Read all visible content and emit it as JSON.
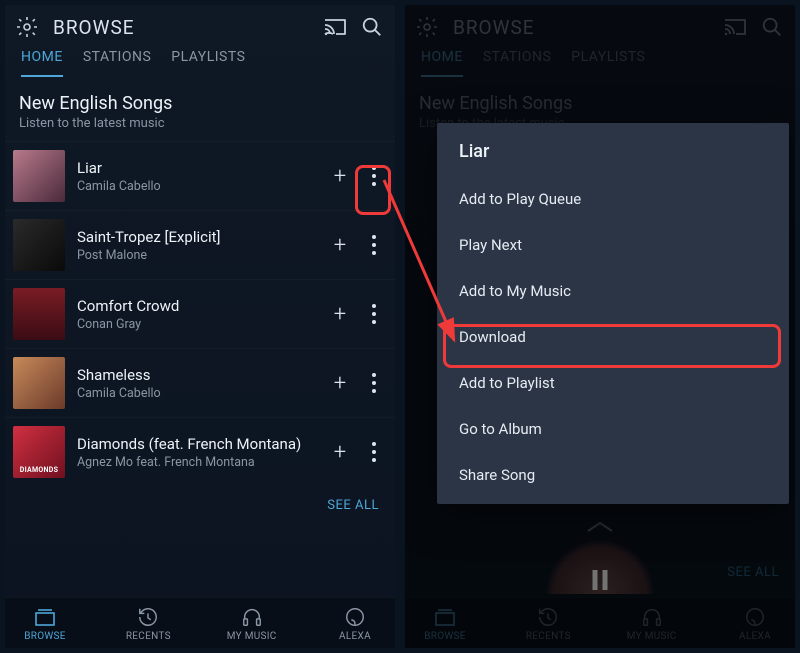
{
  "left": {
    "header": {
      "title": "BROWSE"
    },
    "tabs": [
      "HOME",
      "STATIONS",
      "PLAYLISTS"
    ],
    "active_tab": 0,
    "section": {
      "title": "New English Songs",
      "subtitle": "Listen to the latest music",
      "see_all": "SEE ALL"
    },
    "songs": [
      {
        "title": "Liar",
        "artist": "Camila Cabello"
      },
      {
        "title": "Saint-Tropez [Explicit]",
        "artist": "Post Malone"
      },
      {
        "title": "Comfort Crowd",
        "artist": "Conan Gray"
      },
      {
        "title": "Shameless",
        "artist": "Camila Cabello"
      },
      {
        "title": "Diamonds (feat. French Montana)",
        "artist": "Agnez Mo feat. French Montana"
      }
    ],
    "nav": [
      "BROWSE",
      "RECENTS",
      "MY MUSIC",
      "ALEXA"
    ]
  },
  "right": {
    "header": {
      "title": "BROWSE"
    },
    "tabs": [
      "HOME",
      "STATIONS",
      "PLAYLISTS"
    ],
    "section": {
      "title": "New English Songs",
      "subtitle": "Listen to the latest music",
      "see_all": "SEE ALL"
    },
    "context": {
      "title": "Liar",
      "items": [
        "Add to Play Queue",
        "Play Next",
        "Add to My Music",
        "Download",
        "Add to Playlist",
        "Go to Album",
        "Share Song"
      ]
    },
    "nav": [
      "BROWSE",
      "RECENTS",
      "MY MUSIC",
      "ALEXA"
    ]
  }
}
